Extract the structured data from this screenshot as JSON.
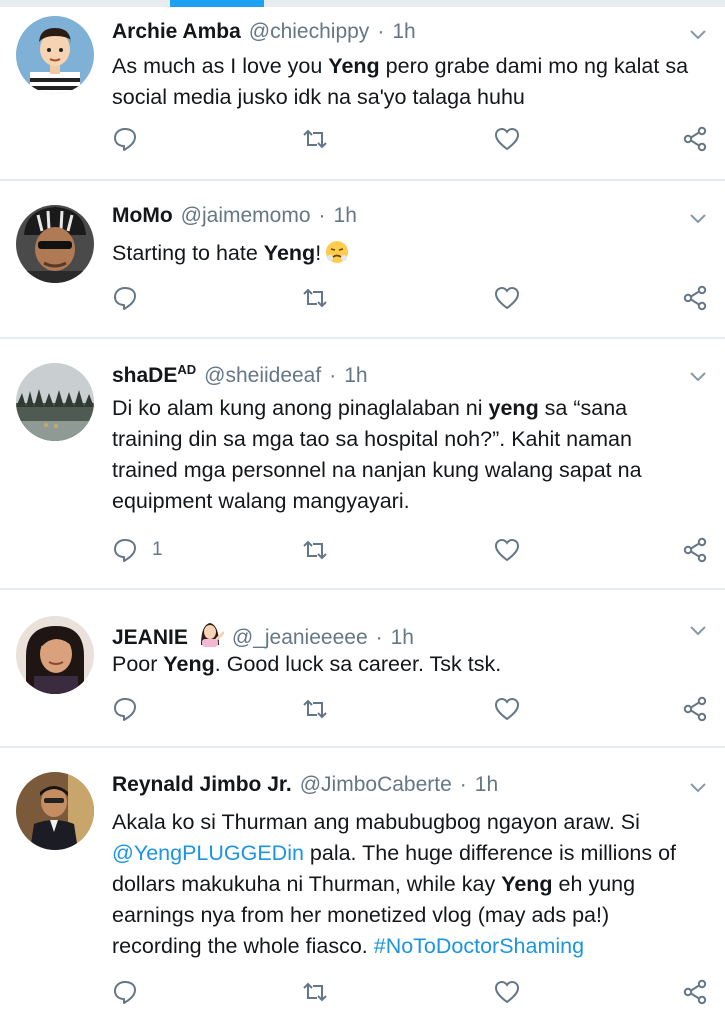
{
  "tweets": [
    {
      "name": "Archie Amba",
      "name_sup": "",
      "handle": "@chiechippy",
      "separator": "·",
      "time": "1h",
      "text_parts": [
        "As much as I love you ",
        "Yeng",
        " pero grabe dami mo ng kalat sa social media jusko idk na sa'yo talaga huhu"
      ],
      "reply_count": ""
    },
    {
      "name": "MoMo",
      "name_sup": "",
      "handle": "@jaimemomo",
      "separator": "·",
      "time": "1h",
      "text_parts": [
        "Starting to hate ",
        "Yeng",
        "!"
      ],
      "reply_count": ""
    },
    {
      "name": "shaDE",
      "name_sup": "AD",
      "handle": "@sheiideeaf",
      "separator": "·",
      "time": "1h",
      "text_parts": [
        "Di ko alam kung anong pinaglalaban ni ",
        "yeng",
        " sa “sana training din sa mga tao sa hospital noh?”. Kahit naman trained mga personnel na nanjan kung walang sapat na equipment walang mangyayari."
      ],
      "reply_count": "1"
    },
    {
      "name": "JEANIE",
      "name_sup": "",
      "handle": "@_jeanieeeee",
      "separator": "·",
      "time": "1h",
      "text_parts": [
        "Poor ",
        "Yeng",
        ". Good luck sa career. Tsk tsk."
      ],
      "reply_count": ""
    },
    {
      "name": "Reynald Jimbo Jr.",
      "name_sup": "",
      "handle": "@JimboCaberte",
      "separator": "·",
      "time": "1h",
      "text_parts": [
        "Akala ko si Thurman ang mabubugbog ngayon araw. Si ",
        "@YengPLUGGEDin",
        " pala. The huge difference is millions of dollars makukuha ni Thurman, while kay ",
        "Yeng",
        " eh yung earnings nya from her monetized vlog (may ads pa!) recording the whole fiasco. ",
        "#NoToDoctorShaming"
      ],
      "reply_count": ""
    }
  ],
  "icons": {
    "reply": "reply-bubble-icon",
    "retweet": "retweet-icon",
    "like": "heart-icon",
    "share": "share-icon",
    "menu": "chevron-down-icon"
  },
  "colors": {
    "text": "#14171a",
    "muted": "#657786",
    "link": "#1b95e0",
    "divider": "#e6ecf0",
    "accent": "#1da1f2"
  }
}
